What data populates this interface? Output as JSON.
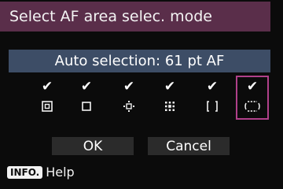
{
  "title": "Select AF area selec. mode",
  "mode_label": "Auto selection: 61 pt AF",
  "options": [
    {
      "icon": "spot-af-icon",
      "checked": "✔"
    },
    {
      "icon": "single-point-af-icon",
      "checked": "✔"
    },
    {
      "icon": "af-point-expansion-cross-icon",
      "checked": "✔"
    },
    {
      "icon": "af-point-expansion-surround-icon",
      "checked": "✔"
    },
    {
      "icon": "zone-af-icon",
      "checked": "✔"
    },
    {
      "icon": "auto-selection-61pt-icon",
      "checked": "✔",
      "selected": true
    }
  ],
  "buttons": {
    "ok": "OK",
    "cancel": "Cancel"
  },
  "info": {
    "badge": "INFO.",
    "label": "Help"
  },
  "colors": {
    "title_bg": "#5a2e4a",
    "mode_bg": "#3d4d66",
    "selection_border": "#b0408a",
    "button_bg": "#2b2b2b"
  }
}
